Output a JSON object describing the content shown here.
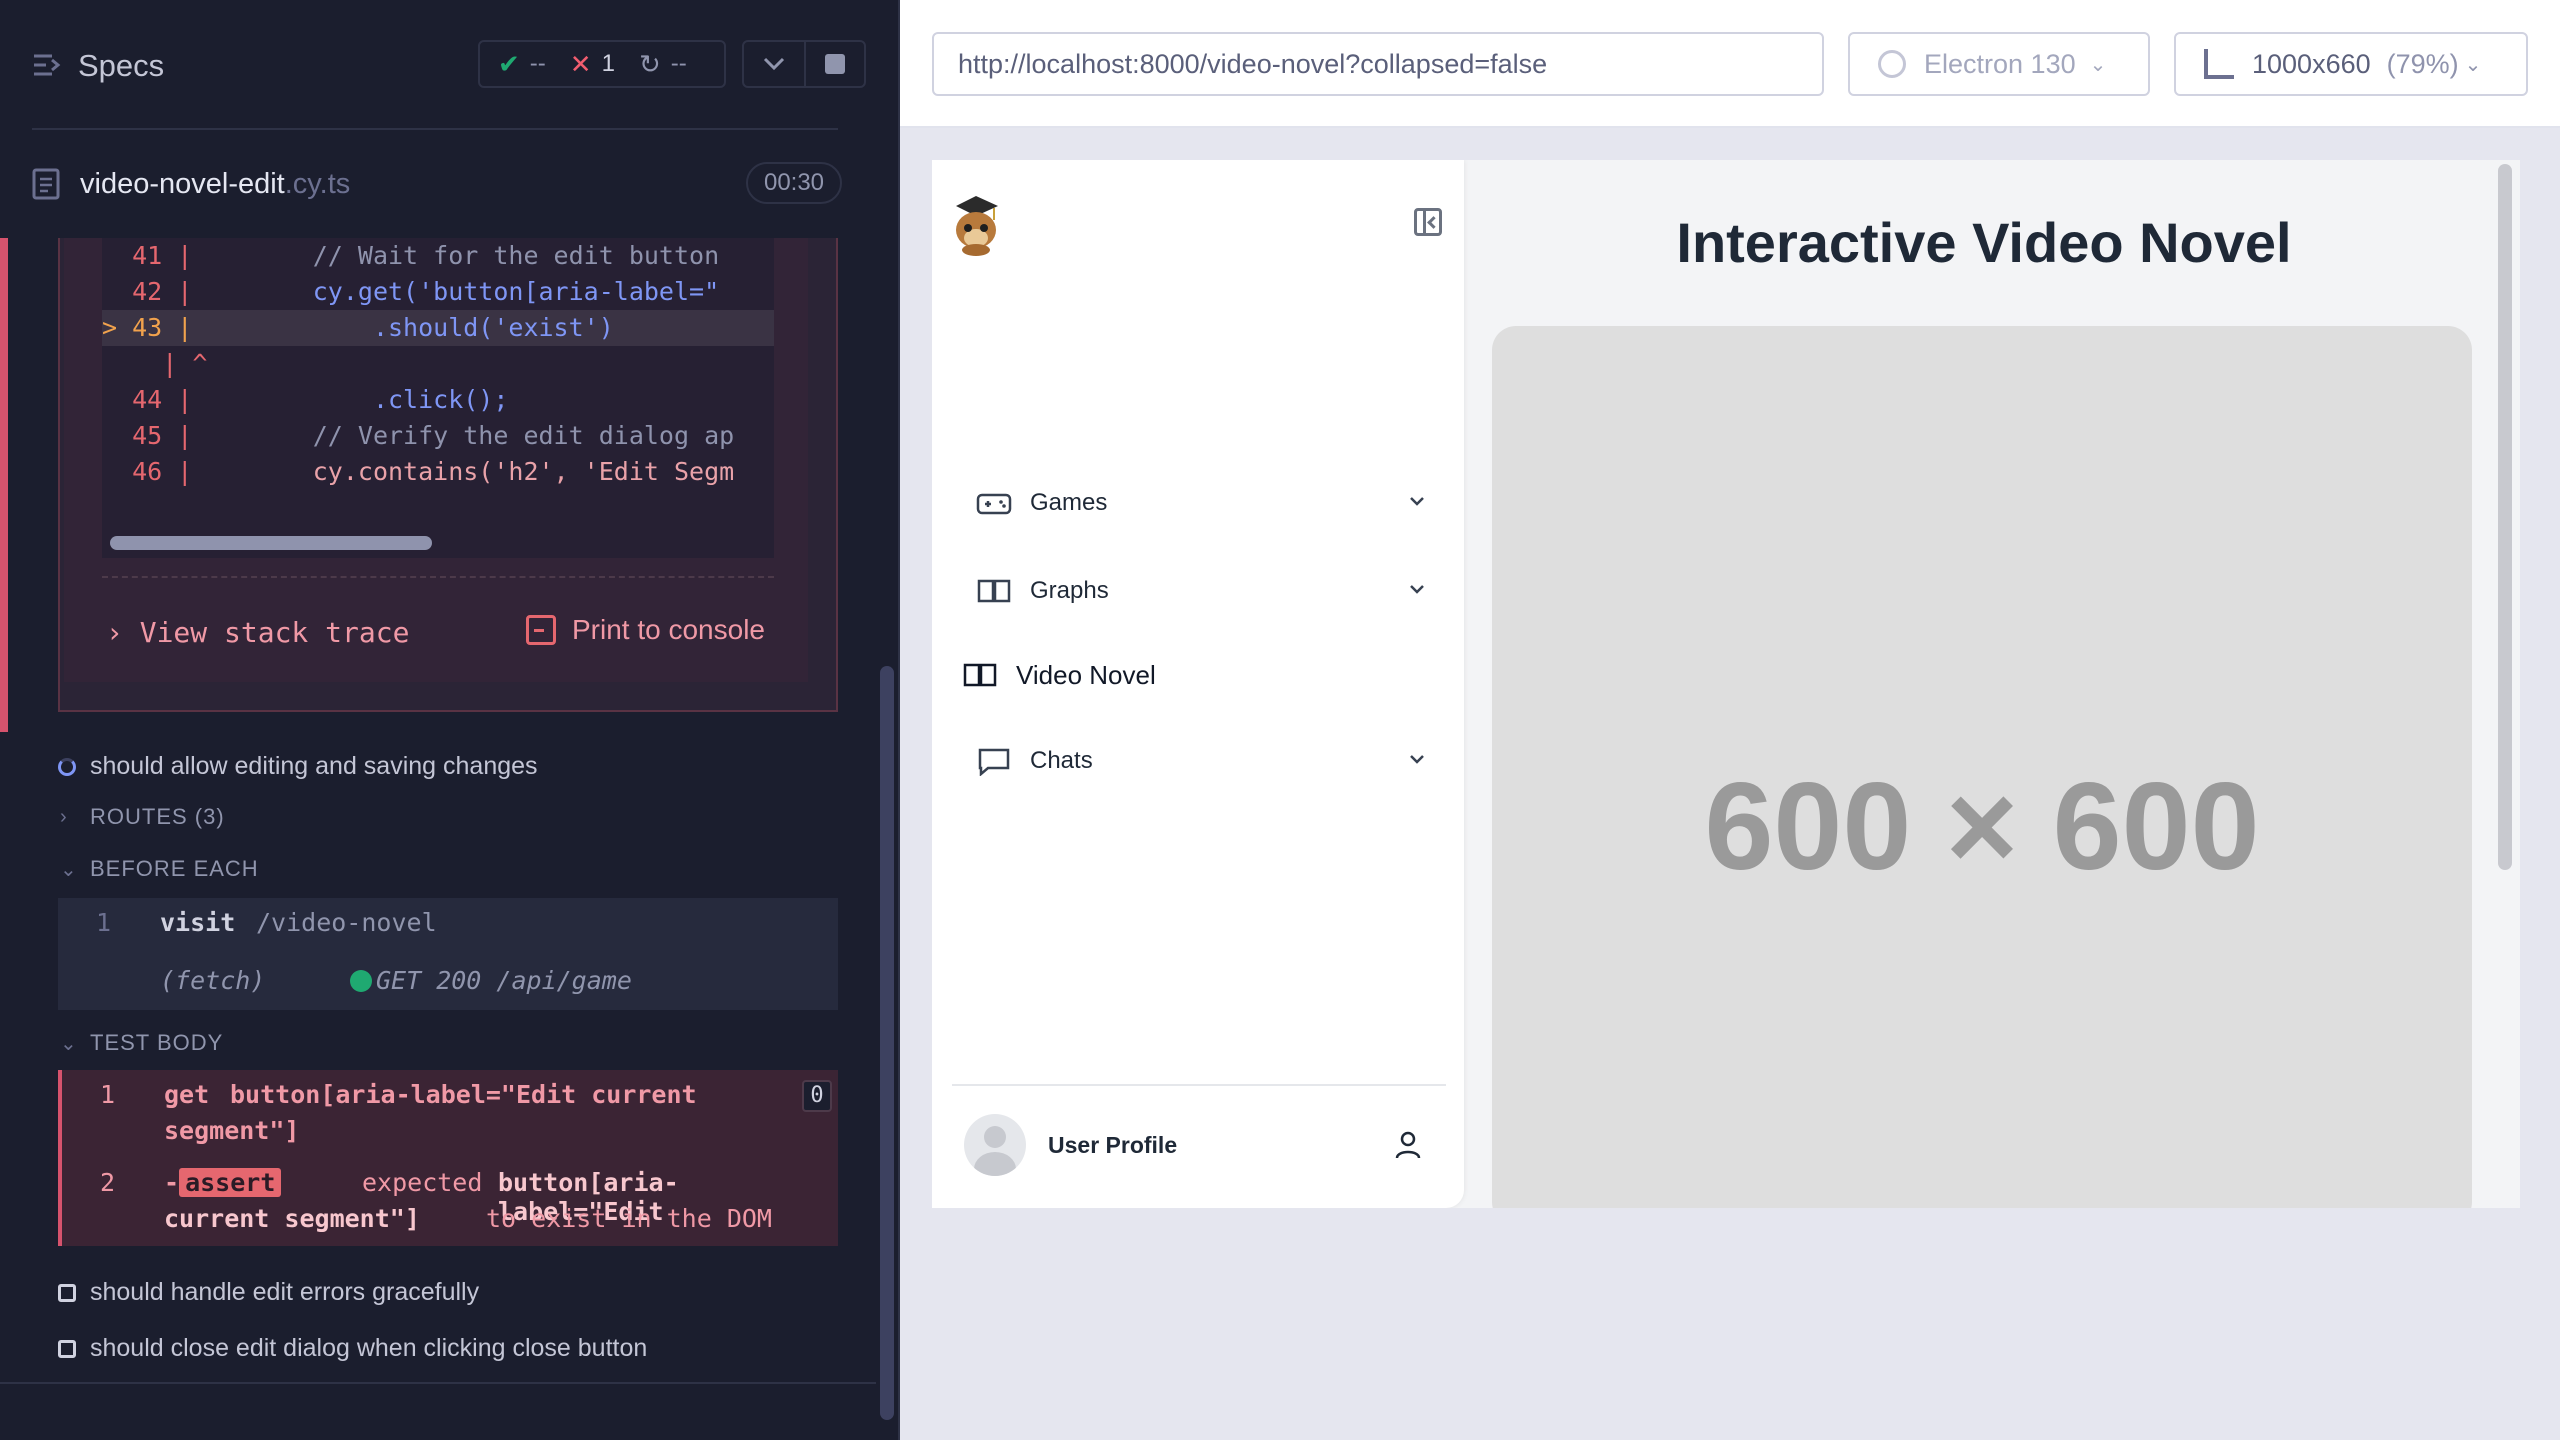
{
  "reporter": {
    "title": "Specs",
    "stats": {
      "passed": "--",
      "failed": "1",
      "pending": "--"
    },
    "spec_file": {
      "name": "video-novel-edit",
      "ext": ".cy.ts",
      "time": "00:30"
    },
    "code_frame": [
      {
        "ln": "41",
        "prefix": "  ",
        "text": "        // Wait for the edit button"
      },
      {
        "ln": "42",
        "prefix": "  ",
        "text": "        cy.get('button[aria-label=\""
      },
      {
        "ln": "43",
        "prefix": "> ",
        "text": "            .should('exist')"
      },
      {
        "ln": "",
        "prefix": "  ",
        "text": "  | ^"
      },
      {
        "ln": "44",
        "prefix": "  ",
        "text": "            .click();"
      },
      {
        "ln": "45",
        "prefix": "  ",
        "text": "        // Verify the edit dialog ap"
      },
      {
        "ln": "46",
        "prefix": "  ",
        "text": "        cy.contains('h2', 'Edit Segm"
      }
    ],
    "stack_trace_label": "View stack trace",
    "print_label": "Print to console",
    "tests": {
      "current": "should allow editing and saving changes",
      "pending1": "should handle edit errors gracefully",
      "pending2": "should close edit dialog when clicking close button"
    },
    "routes_label": "ROUTES (3)",
    "before_each_label": "BEFORE EACH",
    "test_body_label": "TEST BODY",
    "before_each": {
      "num": "1",
      "cmd": "visit",
      "msg": "/video-novel",
      "fetch": "(fetch)",
      "fetch_msg": "GET 200 /api/game"
    },
    "body": {
      "num1": "1",
      "cmd1": "get",
      "msg1": "button[aria-label=\"Edit current",
      "msg1b": "segment\"]",
      "count": "0",
      "num2": "2",
      "dash": "-",
      "cmd2": "assert",
      "msg2a": "expected",
      "msg2b": "button[aria-label=\"Edit",
      "msg2c": "current segment\"]",
      "msg2d": "to exist in the DOM"
    }
  },
  "aut": {
    "url": "http://localhost:8000/video-novel?collapsed=false",
    "browser": "Electron 130",
    "viewport": "1000x660",
    "scale": "(79%)"
  },
  "app": {
    "nav": {
      "games": "Games",
      "graphs": "Graphs",
      "video_novel": "Video Novel",
      "chats": "Chats"
    },
    "user_profile": "User Profile",
    "title": "Interactive Video Novel",
    "placeholder": "600 × 600"
  },
  "colors": {
    "fail": "#d6536d",
    "pass": "#1fa971",
    "accent": "#7f96f5"
  }
}
